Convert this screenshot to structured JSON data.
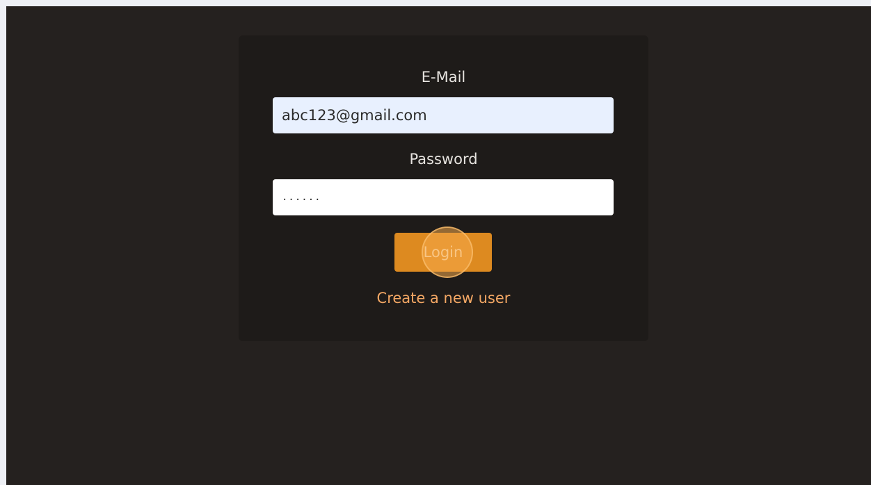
{
  "login_form": {
    "email_label": "E-Mail",
    "email_value": "abc123@gmail.com",
    "password_label": "Password",
    "password_value": "......",
    "login_button_label": "Login",
    "create_user_link": "Create a new user"
  },
  "colors": {
    "page_background": "#25211f",
    "card_background": "#1e1b19",
    "accent": "#dd8a20",
    "link": "#f3a764"
  }
}
